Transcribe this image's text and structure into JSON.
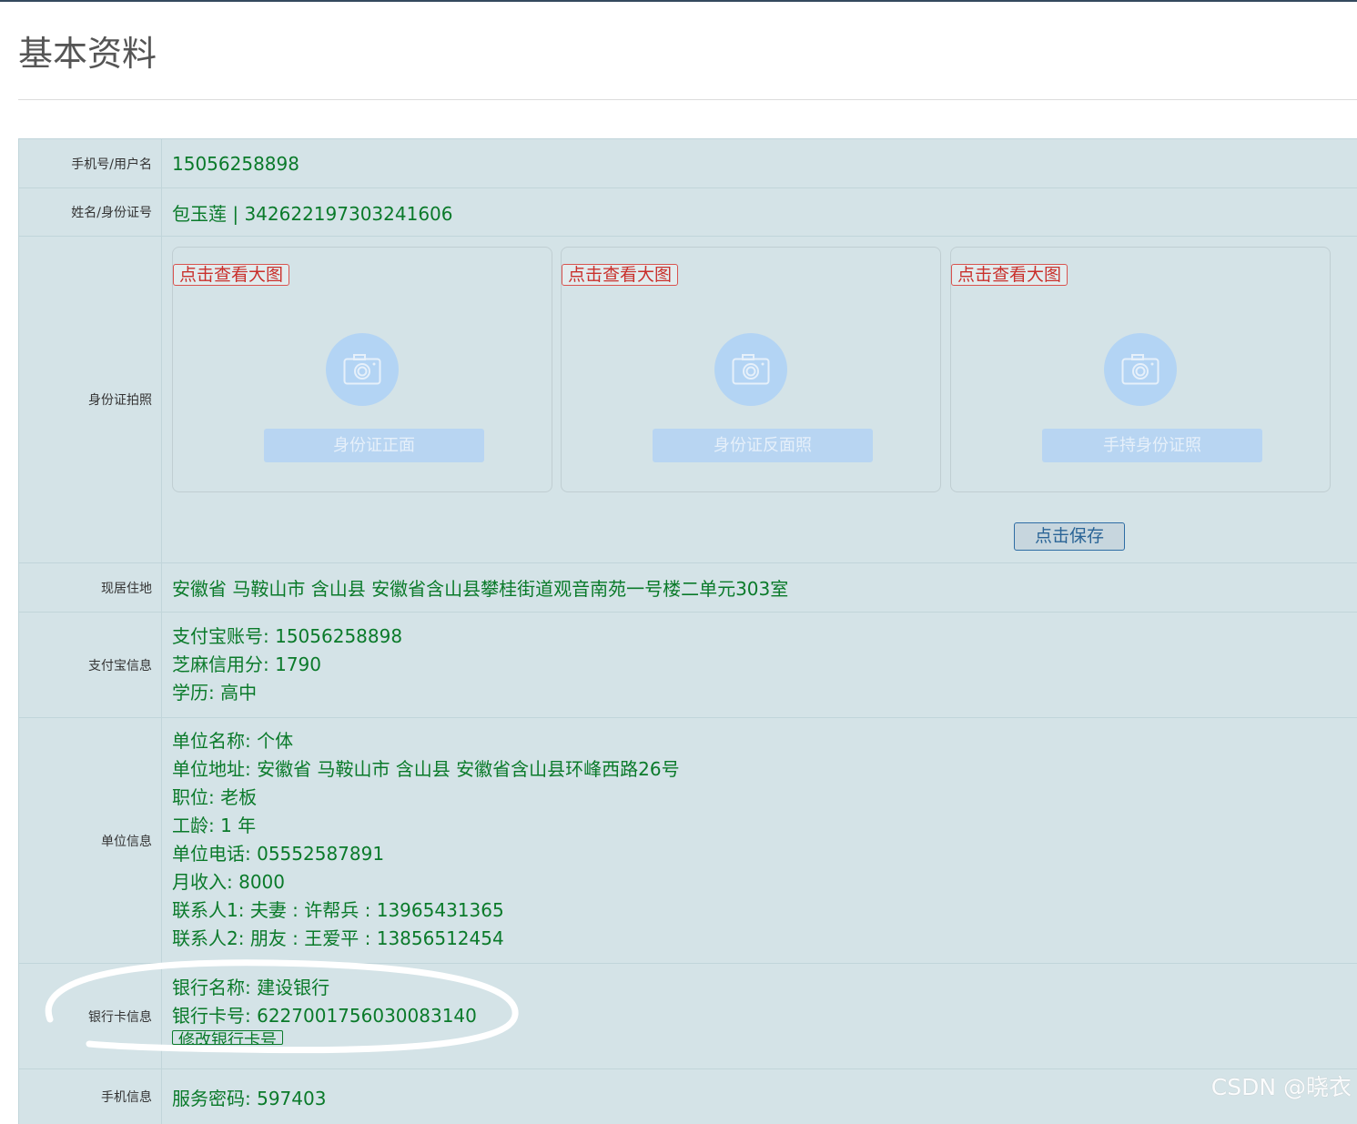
{
  "page": {
    "title": "基本资料"
  },
  "rows": {
    "phone": {
      "label": "手机号/用户名",
      "value": "15056258898"
    },
    "name_id": {
      "label": "姓名/身份证号",
      "value": "包玉莲 | 342622197303241606"
    },
    "id_photos": {
      "label": "身份证拍照",
      "cards": [
        {
          "link": "点击查看大图",
          "button": "身份证正面",
          "icon": "camera-icon"
        },
        {
          "link": "点击查看大图",
          "button": "身份证反面照",
          "icon": "camera-icon"
        },
        {
          "link": "点击查看大图",
          "button": "手持身份证照",
          "icon": "camera-icon"
        }
      ],
      "save": "点击保存"
    },
    "address": {
      "label": "现居住地",
      "value": "安徽省 马鞍山市 含山县 安徽省含山县攀桂街道观音南苑一号楼二单元303室"
    },
    "alipay": {
      "label": "支付宝信息",
      "lines": [
        "支付宝账号: 15056258898",
        "芝麻信用分: 1790",
        "学历: 高中"
      ]
    },
    "company": {
      "label": "单位信息",
      "lines": [
        "单位名称: 个体",
        "单位地址: 安徽省 马鞍山市 含山县 安徽省含山县环峰西路26号",
        "职位: 老板",
        "工龄: 1 年",
        "单位电话: 05552587891",
        "月收入: 8000",
        "联系人1: 夫妻 : 许帮兵 : 13965431365",
        "联系人2: 朋友 : 王爱平 : 13856512454"
      ]
    },
    "bank": {
      "label": "银行卡信息",
      "lines": [
        "银行名称: 建设银行",
        "银行卡号: 6227001756030083140"
      ],
      "edit_button": "修改银行卡号"
    },
    "mobile": {
      "label": "手机信息",
      "lines": [
        "服务密码: 597403"
      ]
    }
  },
  "watermark": "CSDN @晓衣",
  "colors": {
    "value_text": "#0a7a2a",
    "table_bg": "#d4e3e7",
    "link_red": "#c9302c",
    "save_blue": "#2a6496"
  }
}
